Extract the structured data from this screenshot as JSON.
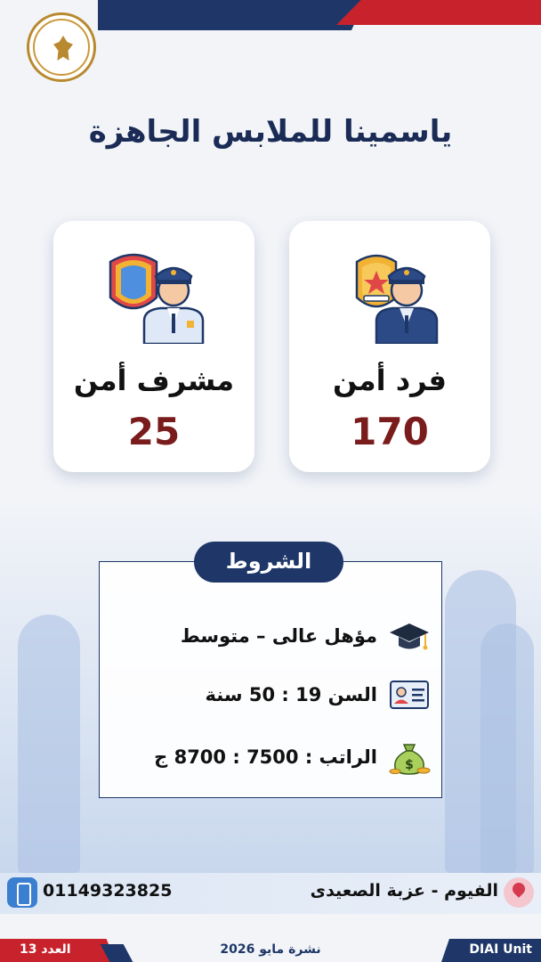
{
  "title": "ياسمينا للملابس الجاهزة",
  "jobs": [
    {
      "label": "فرد أمن",
      "count": "170",
      "icon": "security-guard-badge-icon"
    },
    {
      "label": "مشرف أمن",
      "count": "25",
      "icon": "security-supervisor-shield-icon"
    }
  ],
  "conditions": {
    "heading": "الشروط",
    "items": [
      {
        "text": "مؤهل عالى – متوسط",
        "icon": "graduation-cap-icon"
      },
      {
        "text": "السن 19 : 50 سنة",
        "icon": "id-card-icon"
      },
      {
        "text": "الراتب : 7500 : 8700 ج",
        "icon": "money-bag-icon"
      }
    ]
  },
  "contact": {
    "phone": "01149323825",
    "location": "الفيوم - عزبة الصعيدى"
  },
  "footer": {
    "issue": "العدد 13",
    "bulletin": "نشرة مايو 2026",
    "unit": "DIAI Unit"
  },
  "colors": {
    "navy": "#1e3768",
    "red": "#c8232c",
    "count": "#7a1c1c"
  }
}
